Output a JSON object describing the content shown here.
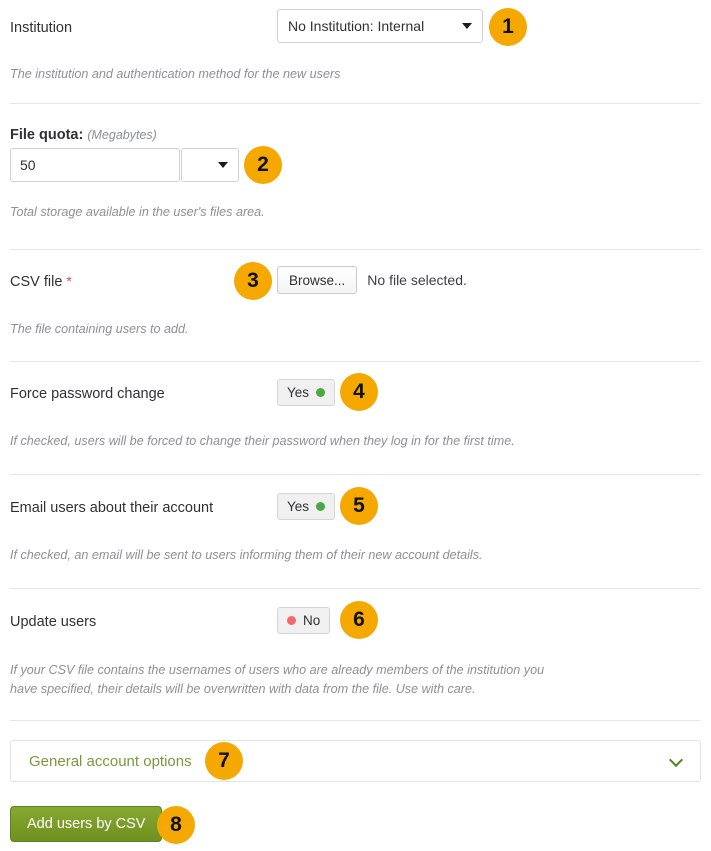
{
  "form": {
    "rows": [
      {
        "id": "institution",
        "label": "Institution",
        "control": "select",
        "value": "No Institution: Internal",
        "help": "The institution and authentication method for the new users",
        "badge": "1"
      },
      {
        "id": "file-quota",
        "label": "File quota:",
        "unit": "(Megabytes)",
        "control": "text-with-select",
        "value": "50",
        "select_value": "",
        "help": "Total storage available in the user's files area.",
        "badge": "2"
      },
      {
        "id": "csv-file",
        "label": "CSV file",
        "required_marker": "*",
        "control": "file",
        "browse_label": "Browse...",
        "file_status": "No file selected.",
        "help": "The file containing users to add.",
        "badge": "3"
      },
      {
        "id": "force-password-change",
        "label": "Force password change",
        "control": "switch",
        "value": "Yes",
        "state": "on",
        "help": "If checked, users will be forced to change their password when they log in for the first time.",
        "badge": "4"
      },
      {
        "id": "email-users",
        "label": "Email users about their account",
        "control": "switch",
        "value": "Yes",
        "state": "on",
        "help": "If checked, an email will be sent to users informing them of their new account details.",
        "badge": "5"
      },
      {
        "id": "update-users",
        "label": "Update users",
        "control": "switch",
        "value": "No",
        "state": "off",
        "help": "If your CSV file contains the usernames of users who are already members of the institution you\nhave specified, their details will be overwritten with data from the file. Use with care.",
        "badge": "6"
      }
    ],
    "collapse": {
      "title": "General account options",
      "badge": "7",
      "chevron": "chevron-down-icon"
    },
    "submit": {
      "label": "Add users by CSV",
      "badge": "8"
    }
  },
  "colors": {
    "badge": "#f5a800",
    "submit": "#7d9c27",
    "link_green": "#7a9a3c",
    "toggle_on": "#49a942",
    "toggle_off": "#ef6b6b",
    "required": "#d9534f",
    "help_text": "#8c9094",
    "divider": "#e6e6e6"
  }
}
